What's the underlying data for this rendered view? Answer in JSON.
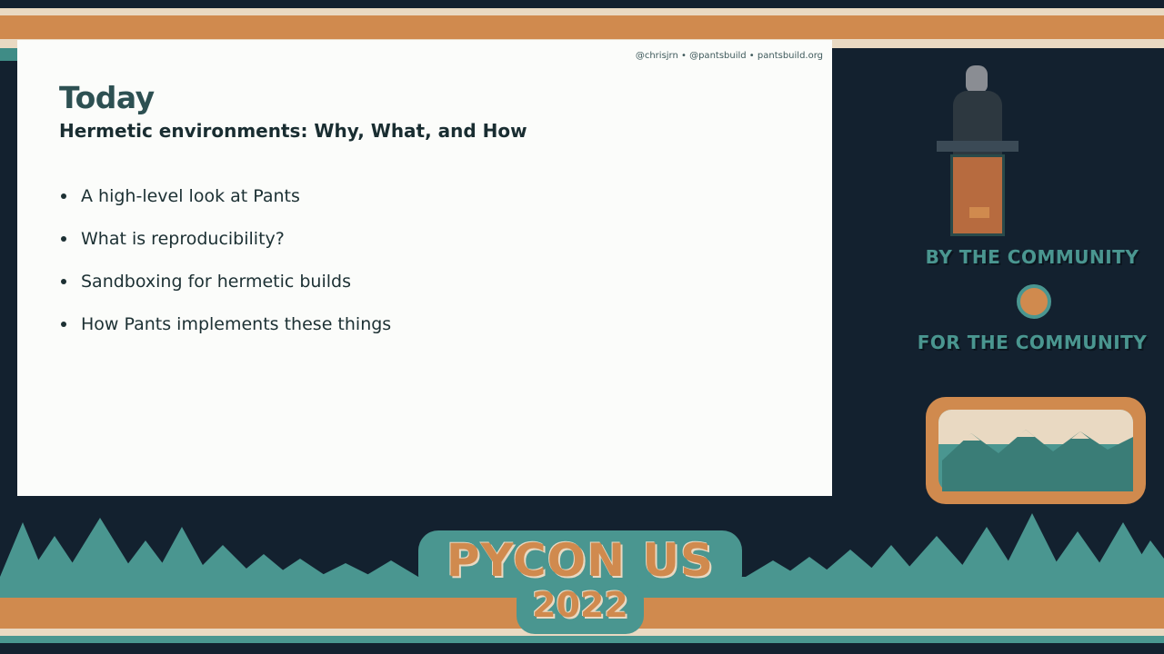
{
  "slide": {
    "credit": "@chrisjrn • @pantsbuild • pantsbuild.org",
    "title": "Today",
    "subtitle": "Hermetic environments: Why, What, and How",
    "bullets": [
      "A high-level look at Pants",
      "What is reproducibility?",
      "Sandboxing for hermetic builds",
      "How Pants implements these things"
    ]
  },
  "sidebar": {
    "line1": "BY THE COMMUNITY",
    "line2": "FOR THE COMMUNITY"
  },
  "event": {
    "name": "PYCON US",
    "year": "2022"
  },
  "colors": {
    "orange": "#d08a4e",
    "teal": "#4a9690",
    "navy": "#13212f",
    "cream": "#e9d9c2"
  }
}
